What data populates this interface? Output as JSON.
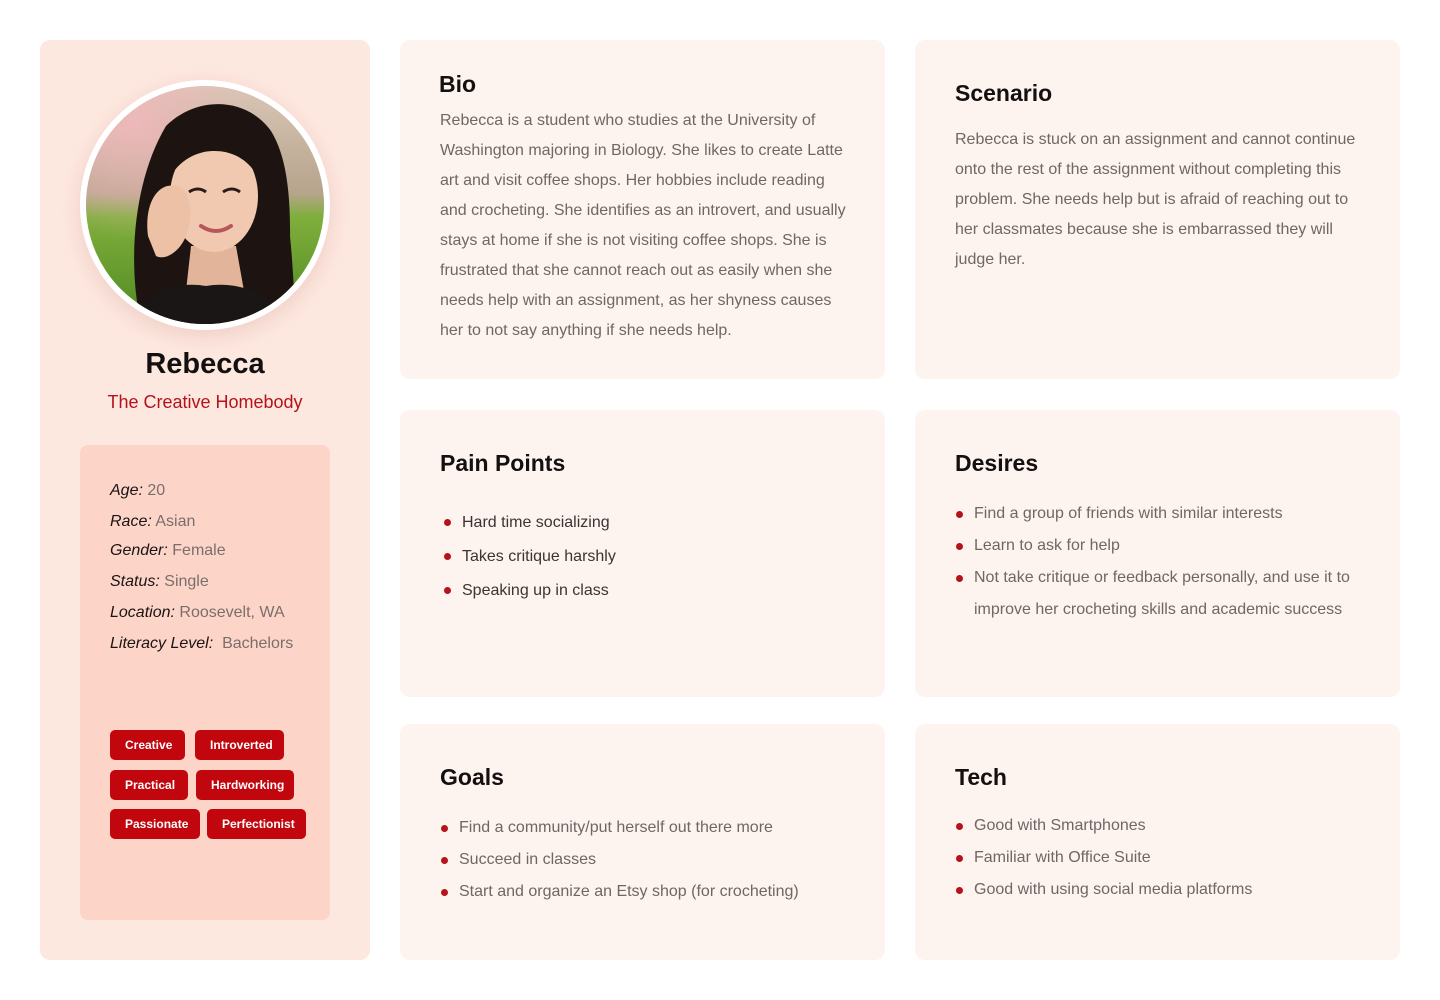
{
  "profile": {
    "name": "Rebecca",
    "tagline": "The Creative Homebody",
    "photo_alt": "portrait",
    "info": [
      {
        "label": "Age:",
        "value": "20"
      },
      {
        "label": "Race:",
        "value": "Asian"
      },
      {
        "label": "Gender:",
        "value": "Female"
      },
      {
        "label": "Status:",
        "value": "Single"
      },
      {
        "label": "Location:",
        "value": "Roosevelt, WA"
      },
      {
        "label": "Literacy Level:",
        "value": "Bachelors"
      }
    ],
    "traits": [
      "Creative",
      "Introverted",
      "Practical",
      "Hardworking",
      "Passionate",
      "Perfectionist"
    ]
  },
  "bio": {
    "title": "Bio",
    "text": "Rebecca is a student who studies at the University of Washington majoring in Biology. She likes to create Latte art and visit coffee shops. Her hobbies include reading and crocheting.  She identifies as an introvert, and usually stays at home if she is not visiting coffee shops.  She is frustrated that she cannot reach out as easily when she needs help with an assignment, as her shyness causes her to not say anything if she needs help."
  },
  "scenario": {
    "title": "Scenario",
    "text": "Rebecca is stuck on an assignment and cannot continue onto the rest of the assignment without completing this problem. She needs help but is afraid of reaching out to her classmates because she is embarrassed they will judge her."
  },
  "pain_points": {
    "title": "Pain Points",
    "items": [
      "Hard time socializing",
      "Takes critique harshly",
      "Speaking up in class"
    ]
  },
  "desires": {
    "title": "Desires",
    "items": [
      "Find a group of friends with similar interests",
      "Learn to ask for help",
      "Not take critique or feedback personally, and use it to improve her crocheting skills and academic success"
    ]
  },
  "goals": {
    "title": "Goals",
    "items": [
      "Find a community/put herself out there more",
      "Succeed in classes",
      "Start and organize an Etsy shop (for crocheting)"
    ]
  },
  "tech": {
    "title": "Tech",
    "items": [
      "Good with Smartphones",
      "Familiar with Office Suite",
      "Good with using social media platforms"
    ]
  },
  "colors": {
    "accent": "#c1060d",
    "profile_bg": "#fde8e0",
    "info_bg": "#fdd5c8",
    "panel_bg": "#fdf3ef"
  }
}
